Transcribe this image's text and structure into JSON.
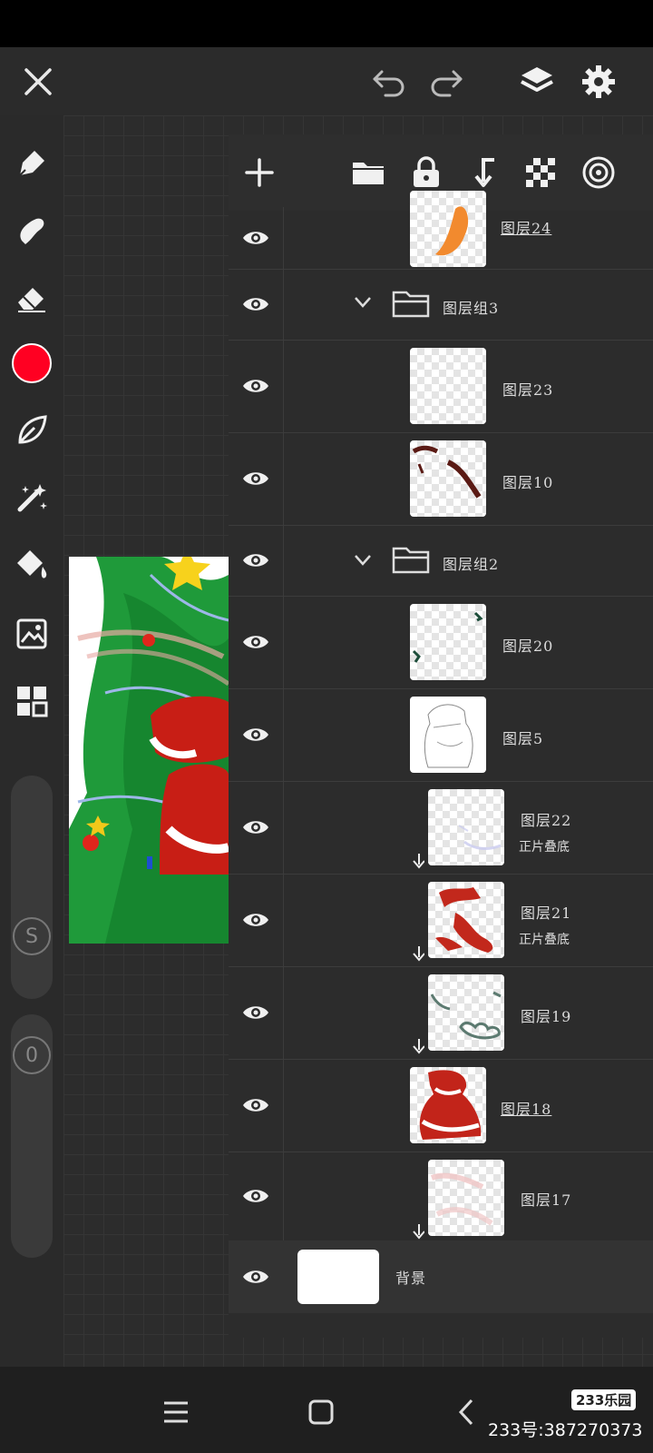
{
  "colors": {
    "accent": "#ff0022",
    "panel": "#2c2c2c",
    "toolbar": "#2b2b2b",
    "icon": "#f0f0f0"
  },
  "top_bar": {
    "icons": [
      "close-icon",
      "undo-icon",
      "redo-icon",
      "layers-icon",
      "settings-icon"
    ]
  },
  "tools": {
    "icons": [
      "pen-icon",
      "smudge-icon",
      "eraser-icon",
      "color-swatch",
      "leaf-icon",
      "magic-wand-icon",
      "fill-bucket-icon",
      "image-icon",
      "grid-icon"
    ],
    "current_color": "#ff0022"
  },
  "sliders": {
    "size_label": "S",
    "opacity_label": "0"
  },
  "layers_toolbar": {
    "icons": [
      "add-layer-icon",
      "folder-icon",
      "lock-icon",
      "merge-down-icon",
      "transparency-icon",
      "target-icon"
    ]
  },
  "layers": [
    {
      "name": "图层24",
      "active": true
    },
    {
      "name": "图层组3",
      "type": "group"
    },
    {
      "name": "图层23"
    },
    {
      "name": "图层10"
    },
    {
      "name": "图层组2",
      "type": "group"
    },
    {
      "name": "图层20"
    },
    {
      "name": "图层5"
    },
    {
      "name": "图层22",
      "mode": "正片叠底"
    },
    {
      "name": "图层21",
      "mode": "正片叠底"
    },
    {
      "name": "图层19"
    },
    {
      "name": "图层18",
      "active": true
    },
    {
      "name": "图层17"
    },
    {
      "name": "背景"
    }
  ],
  "nav": {
    "icons": [
      "menu-icon",
      "home-icon",
      "back-icon"
    ]
  },
  "watermark": {
    "logo": "233乐园",
    "text": "233号:387270373"
  }
}
